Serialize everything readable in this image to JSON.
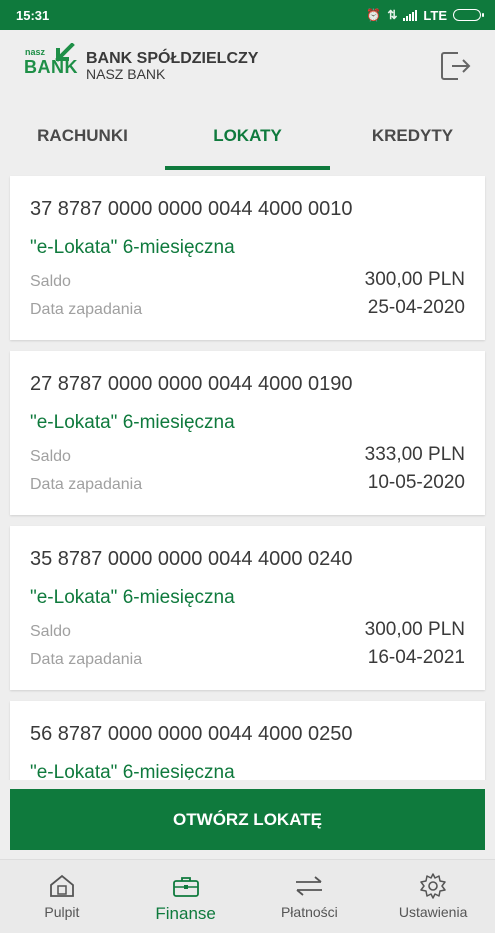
{
  "status_bar": {
    "time": "15:31",
    "network": "LTE"
  },
  "header": {
    "logo_small": "nasz",
    "logo_big": "BANK",
    "title": "BANK SPÓŁDZIELCZY",
    "subtitle": "NASZ BANK"
  },
  "tabs": [
    {
      "label": "RACHUNKI",
      "active": false
    },
    {
      "label": "LOKATY",
      "active": true
    },
    {
      "label": "KREDYTY",
      "active": false
    }
  ],
  "deposits": [
    {
      "account": "37 8787 0000 0000 0044 4000 0010",
      "name": "\"e-Lokata\" 6-miesięczna",
      "balance_label": "Saldo",
      "balance": "300,00 PLN",
      "due_label": "Data zapadania",
      "due_date": "25-04-2020"
    },
    {
      "account": "27 8787 0000 0000 0044 4000 0190",
      "name": "\"e-Lokata\" 6-miesięczna",
      "balance_label": "Saldo",
      "balance": "333,00 PLN",
      "due_label": "Data zapadania",
      "due_date": "10-05-2020"
    },
    {
      "account": "35 8787 0000 0000 0044 4000 0240",
      "name": "\"e-Lokata\" 6-miesięczna",
      "balance_label": "Saldo",
      "balance": "300,00 PLN",
      "due_label": "Data zapadania",
      "due_date": "16-04-2021"
    },
    {
      "account": "56 8787 0000 0000 0044 4000 0250",
      "name": "\"e-Lokata\" 6-miesięczna"
    }
  ],
  "open_button": "OTWÓRZ LOKATĘ",
  "bottom_nav": [
    {
      "label": "Pulpit",
      "icon": "home-icon",
      "active": false
    },
    {
      "label": "Finanse",
      "icon": "briefcase-icon",
      "active": true
    },
    {
      "label": "Płatności",
      "icon": "transfer-arrows-icon",
      "active": false
    },
    {
      "label": "Ustawienia",
      "icon": "gear-icon",
      "active": false
    }
  ],
  "colors": {
    "brand_green": "#0f7a3d",
    "logo_green": "#1e8f47",
    "background": "#eeeeee"
  }
}
